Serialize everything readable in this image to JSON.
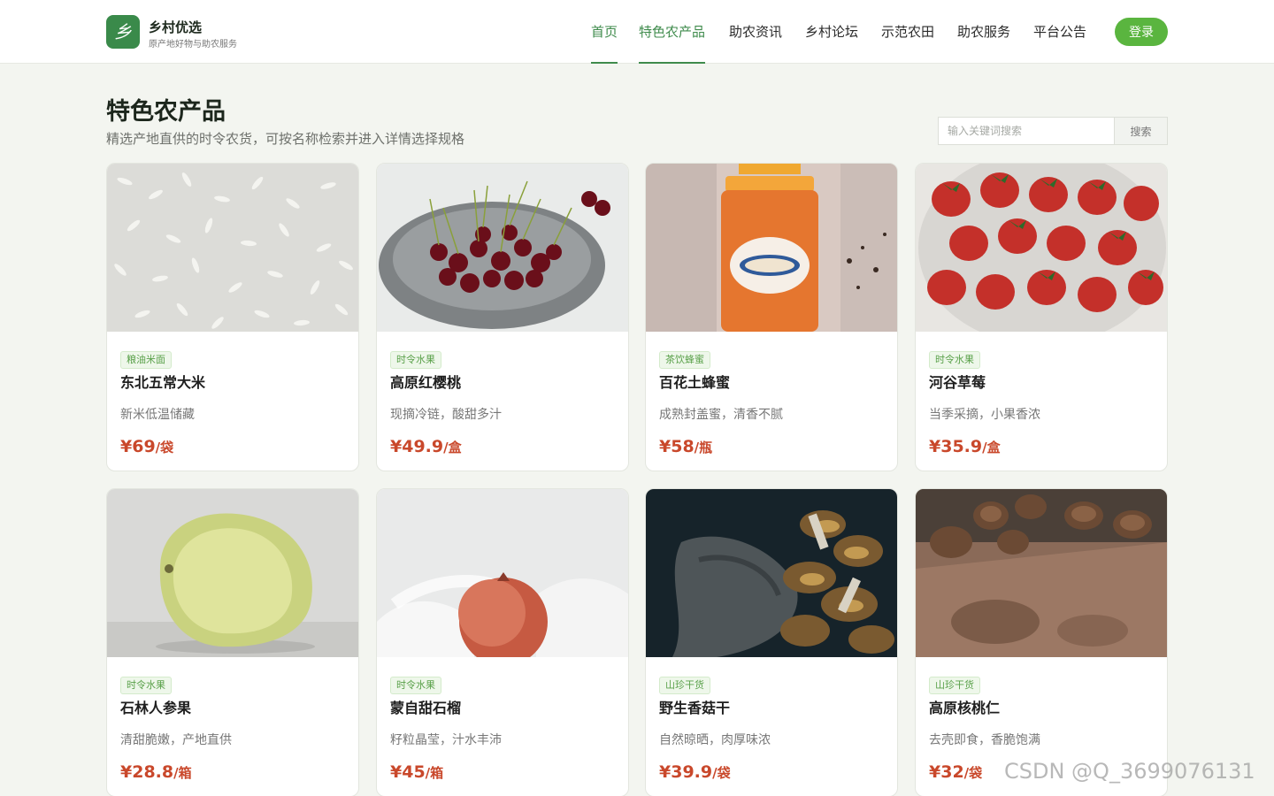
{
  "header": {
    "logo_glyph": "乡",
    "site_title": "乡村优选",
    "site_subtitle": "原产地好物与助农服务",
    "nav": [
      {
        "label": "首页"
      },
      {
        "label": "特色农产品"
      },
      {
        "label": "助农资讯"
      },
      {
        "label": "乡村论坛"
      },
      {
        "label": "示范农田"
      },
      {
        "label": "助农服务"
      },
      {
        "label": "平台公告"
      }
    ],
    "active_nav": "特色农产品",
    "login_label": "登录"
  },
  "page": {
    "title": "特色农产品",
    "subtitle": "精选产地直供的时令农货，可按名称检索并进入详情选择规格",
    "search": {
      "placeholder": "输入关键词搜索",
      "button_label": "搜索"
    }
  },
  "products": [
    {
      "category": "粮油米面",
      "name": "东北五常大米",
      "desc": "新米低温储藏",
      "price": "¥69",
      "unit": "/袋",
      "image": "rice"
    },
    {
      "category": "时令水果",
      "name": "高原红樱桃",
      "desc": "现摘冷链，酸甜多汁",
      "price": "¥49.9",
      "unit": "/盒",
      "image": "cherries"
    },
    {
      "category": "茶饮蜂蜜",
      "name": "百花土蜂蜜",
      "desc": "成熟封盖蜜，清香不腻",
      "price": "¥58",
      "unit": "/瓶",
      "image": "honey-jar"
    },
    {
      "category": "时令水果",
      "name": "河谷草莓",
      "desc": "当季采摘，小果香浓",
      "price": "¥35.9",
      "unit": "/盒",
      "image": "strawberries"
    },
    {
      "category": "时令水果",
      "name": "石林人参果",
      "desc": "清甜脆嫩，产地直供",
      "price": "¥28.8",
      "unit": "/箱",
      "image": "pepino"
    },
    {
      "category": "时令水果",
      "name": "蒙自甜石榴",
      "desc": "籽粒晶莹，汁水丰沛",
      "price": "¥45",
      "unit": "/箱",
      "image": "pomegranate"
    },
    {
      "category": "山珍干货",
      "name": "野生香菇干",
      "desc": "自然晾晒，肉厚味浓",
      "price": "¥39.9",
      "unit": "/袋",
      "image": "mushrooms"
    },
    {
      "category": "山珍干货",
      "name": "高原核桃仁",
      "desc": "去壳即食，香脆饱满",
      "price": "¥32",
      "unit": "/袋",
      "image": "walnuts"
    }
  ],
  "watermark": "CSDN @Q_3699076131",
  "colors": {
    "brand_green": "#3f8b4c",
    "login_green": "#5ab53f",
    "price_red": "#c9482b",
    "badge_green": "#5aa14a",
    "page_bg": "#f3f5f0"
  }
}
